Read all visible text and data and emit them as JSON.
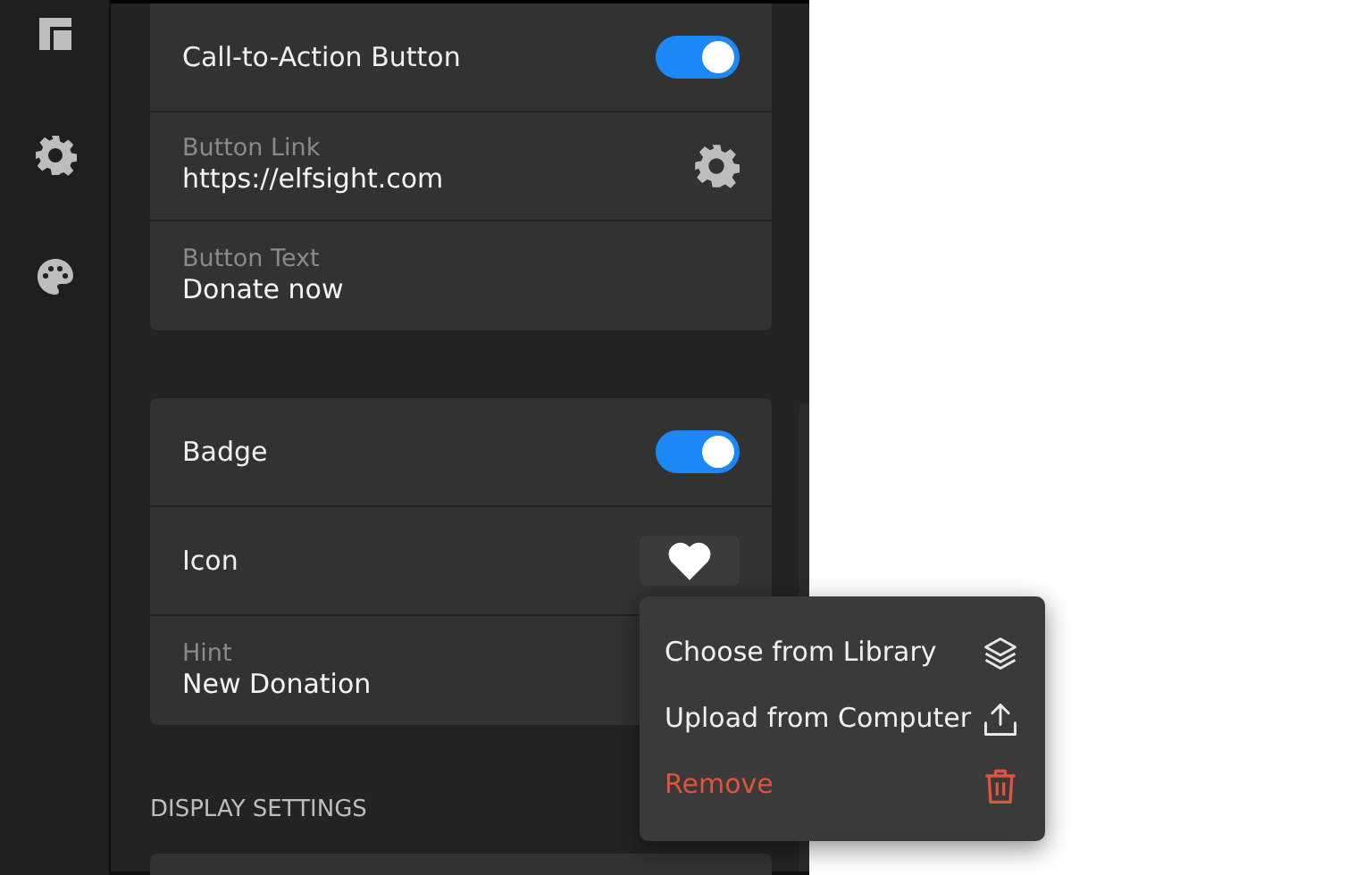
{
  "sections": [
    {
      "rows": [
        {
          "kind": "toggle",
          "label": "Call-to-Action Button",
          "on": true
        },
        {
          "kind": "field_gear",
          "label": "Button Link",
          "value": "https://elfsight.com"
        },
        {
          "kind": "field",
          "label": "Button Text",
          "value": "Donate now"
        }
      ]
    },
    {
      "rows": [
        {
          "kind": "toggle",
          "label": "Badge",
          "on": true
        },
        {
          "kind": "icon_picker",
          "label": "Icon"
        },
        {
          "kind": "field",
          "label": "Hint",
          "value": "New Donation"
        }
      ]
    },
    {
      "heading": "DISPLAY SETTINGS"
    }
  ],
  "menu": [
    {
      "kind": "library",
      "label": "Choose from Library"
    },
    {
      "kind": "upload",
      "label": "Upload from Computer"
    },
    {
      "kind": "remove",
      "label": "Remove"
    }
  ]
}
